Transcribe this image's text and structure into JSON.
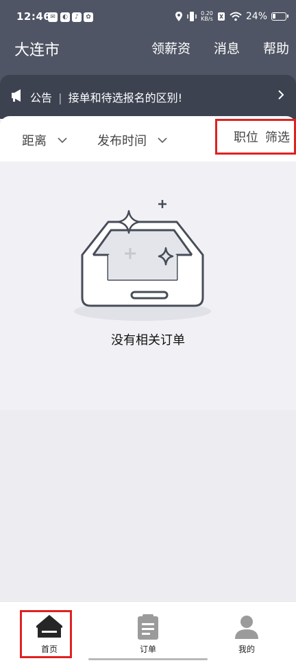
{
  "status_bar": {
    "time": "12:46",
    "net_speed_value": "0.20",
    "net_speed_unit": "KB/s",
    "battery_percent": "24%",
    "battery_level": 0.24
  },
  "navbar": {
    "city": "大连市",
    "links": [
      "领薪资",
      "消息",
      "帮助"
    ]
  },
  "announcement": {
    "label": "公告",
    "separator": "|",
    "text": "接单和待选报名的区别!"
  },
  "filters": {
    "distance": "距离",
    "publish_time": "发布时间",
    "position": "职位",
    "screen": "筛选"
  },
  "empty_state": {
    "text": "没有相关订单"
  },
  "tabs": [
    {
      "label": "首页",
      "icon": "home-icon",
      "active": true
    },
    {
      "label": "订单",
      "icon": "orders-icon",
      "active": false
    },
    {
      "label": "我的",
      "icon": "profile-icon",
      "active": false
    }
  ],
  "colors": {
    "header_bg": "#4f5564",
    "announcement_bg": "#3c4250",
    "highlight_red": "#e02020"
  }
}
